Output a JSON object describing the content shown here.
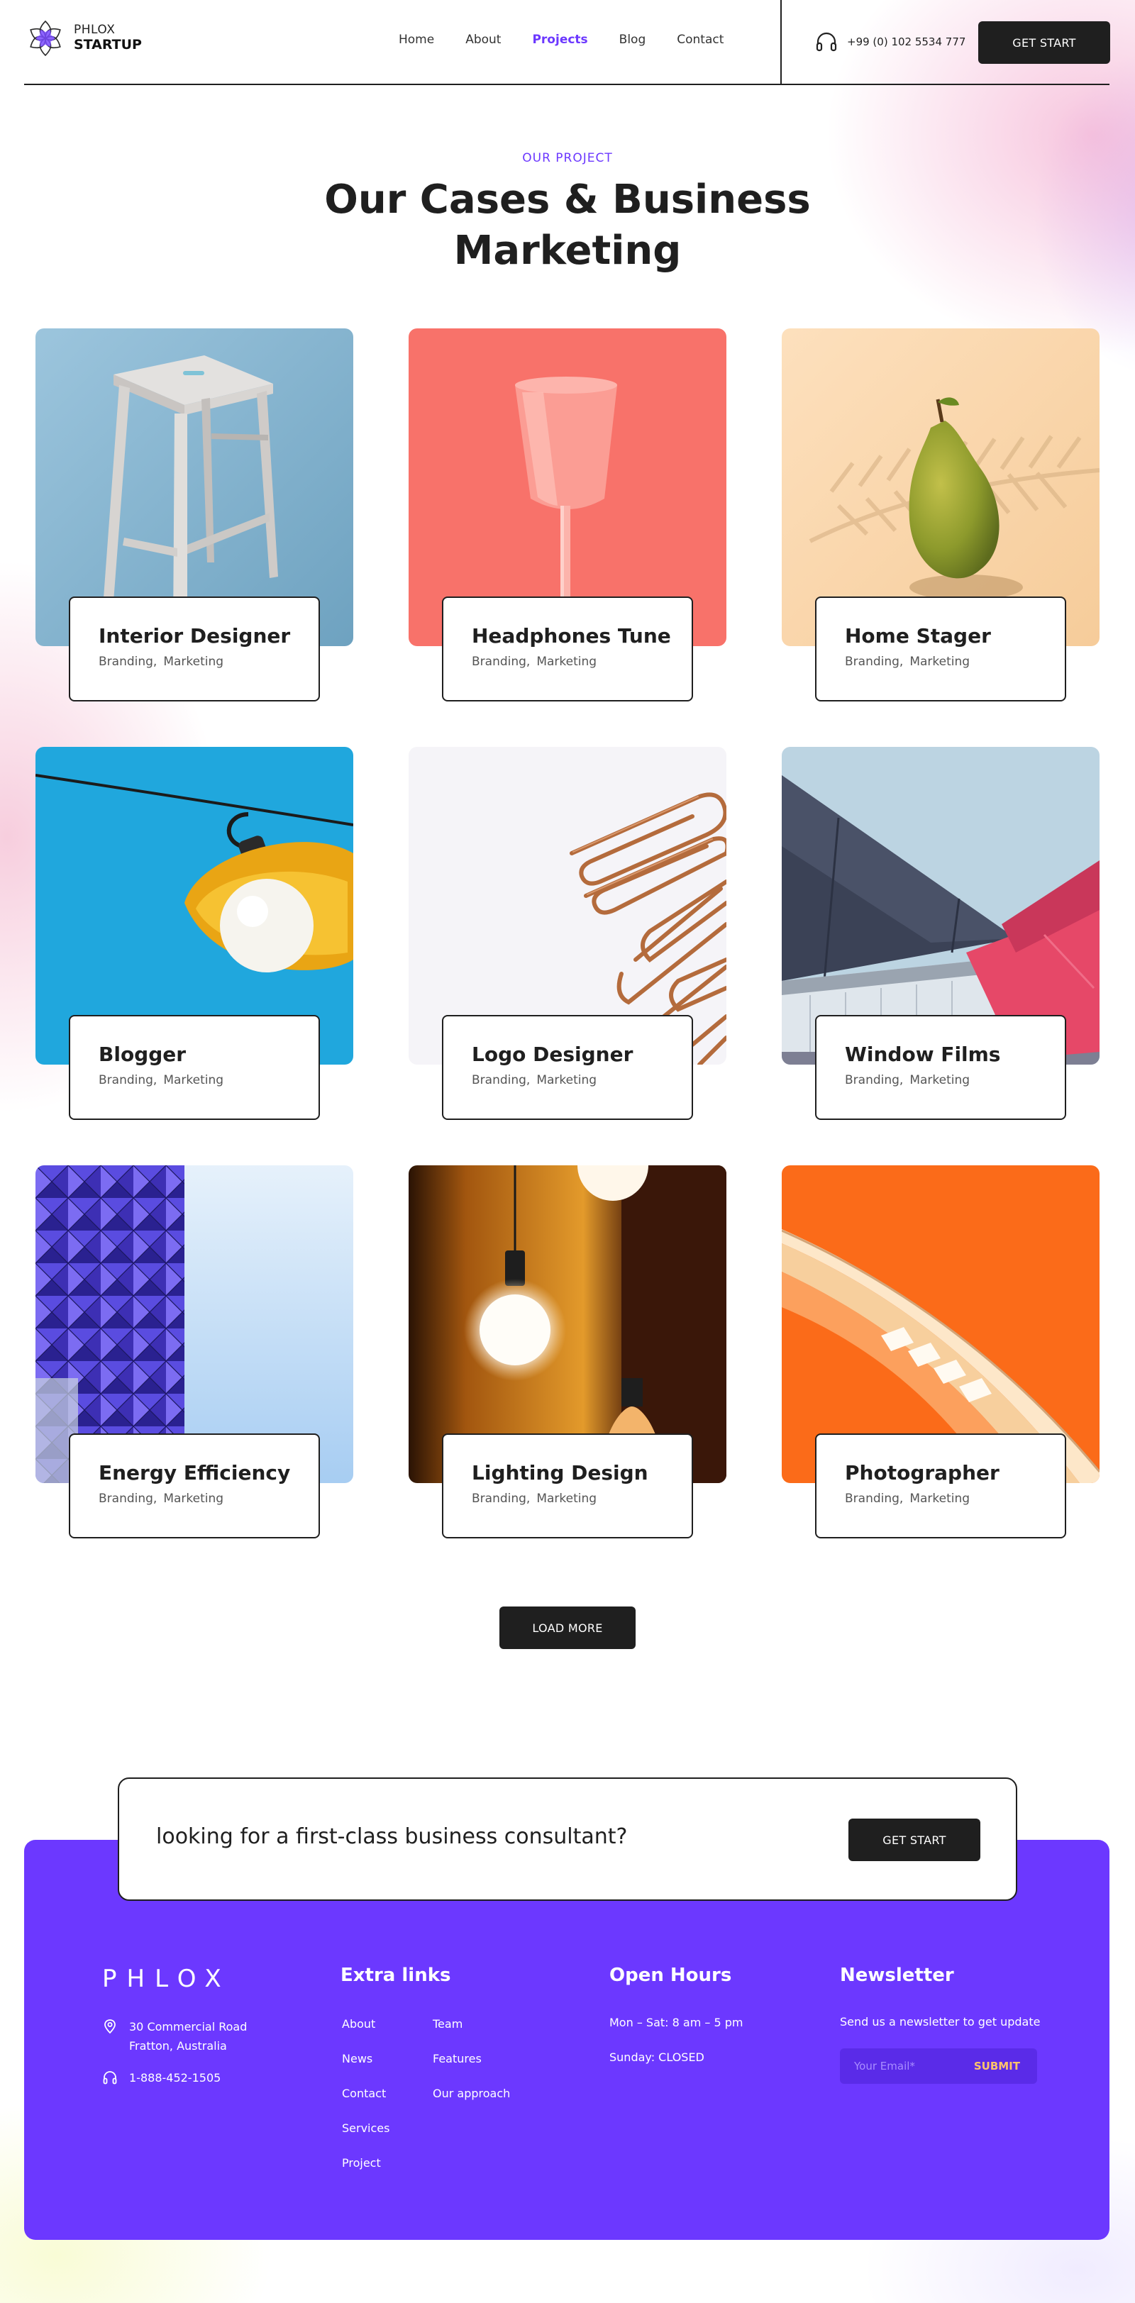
{
  "header": {
    "logo_top": "PHLOX",
    "logo_bottom": "STARTUP",
    "nav": [
      {
        "label": "Home",
        "active": false
      },
      {
        "label": "About",
        "active": false
      },
      {
        "label": "Projects",
        "active": true
      },
      {
        "label": "Blog",
        "active": false
      },
      {
        "label": "Contact",
        "active": false
      }
    ],
    "phone": "+99 (0) 102 5534 777",
    "cta_label": "GET START"
  },
  "section": {
    "eyebrow": "OUR PROJECT",
    "title": "Our Cases & Business Marketing"
  },
  "projects": [
    {
      "title": "Interior Designer",
      "tags": [
        "Branding,",
        "Marketing"
      ],
      "image": "stool-photo"
    },
    {
      "title": "Headphones Tune",
      "tags": [
        "Branding,",
        "Marketing"
      ],
      "image": "pink-glass-photo"
    },
    {
      "title": "Home Stager",
      "tags": [
        "Branding,",
        "Marketing"
      ],
      "image": "pear-photo"
    },
    {
      "title": "Blogger",
      "tags": [
        "Branding,",
        "Marketing"
      ],
      "image": "lamp-photo"
    },
    {
      "title": "Logo Designer",
      "tags": [
        "Branding,",
        "Marketing"
      ],
      "image": "paperclips-photo"
    },
    {
      "title": "Window Films",
      "tags": [
        "Branding,",
        "Marketing"
      ],
      "image": "building-photo"
    },
    {
      "title": "Energy Efficiency",
      "tags": [
        "Branding,",
        "Marketing"
      ],
      "image": "facade-photo"
    },
    {
      "title": "Lighting Design",
      "tags": [
        "Branding,",
        "Marketing"
      ],
      "image": "bulb-photo"
    },
    {
      "title": "Photographer",
      "tags": [
        "Branding,",
        "Marketing"
      ],
      "image": "orange-stairs-photo"
    }
  ],
  "load_more": "LOAD MORE",
  "cta": {
    "text": "looking for a first-class business consultant?",
    "button": "GET START"
  },
  "footer": {
    "brand": "PHLOX",
    "address_line1": "30 Commercial Road",
    "address_line2": "Fratton, Australia",
    "phone": "1-888-452-1505",
    "extra_links_title": "Extra links",
    "links_col1": [
      "About",
      "News",
      "Contact",
      "Services",
      "Project"
    ],
    "links_col2": [
      "Team",
      "Features",
      "Our approach"
    ],
    "hours_title": "Open Hours",
    "hours": [
      "Mon – Sat: 8 am – 5 pm",
      "Sunday: CLOSED"
    ],
    "newsletter_title": "Newsletter",
    "newsletter_text": "Send us a newsletter to get update",
    "email_placeholder": "Your Email*",
    "submit": "SUBMIT"
  },
  "colors": {
    "accent": "#6c38ff",
    "dark": "#1f1f1f",
    "submit": "#ffc46b"
  }
}
